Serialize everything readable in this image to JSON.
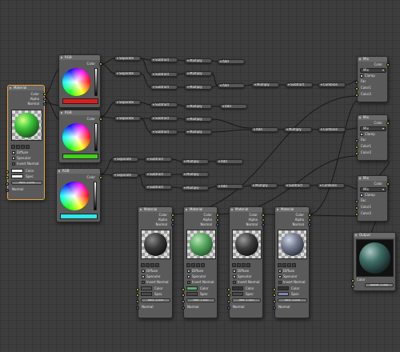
{
  "node_titles": {
    "material": "Material",
    "rgb": "RGB",
    "mix": "Mix",
    "output": "Output",
    "separate": "Separate",
    "subtract": "Subtract",
    "multiply": "Multiply",
    "add": "Add",
    "combine": "Combine"
  },
  "sockets": {
    "color": "Color",
    "alpha": "Alpha",
    "normal": "Normal",
    "fac": "Fac",
    "color1": "Color1",
    "color2": "Color2",
    "spec": "Spec",
    "refl": "Refl"
  },
  "options": {
    "diffuse": "Diffuse",
    "specular": "Specular",
    "invert_normal": "Invert Normal",
    "clamp": "Clamp",
    "mix_mode": "Mix",
    "refl_value": "Refl: 1.000",
    "alpha_value": "Alpha: 1.000"
  },
  "colors": {
    "background": "#3d3d3d",
    "node_body": "#5a5a5a",
    "node_header": "#6a6a6a",
    "socket_color": "#cccc33",
    "socket_value": "#a1a1a1",
    "socket_vector": "#6363c7",
    "selected_outline": "#e8a33e",
    "rgb1_swatch": "#e21a1a",
    "rgb2_swatch": "#3fd11a",
    "rgb3_swatch": "#30e6e6"
  },
  "icons": [
    "collapse-triangle-icon",
    "node-socket-icon",
    "checkbox-check-icon",
    "dropdown-arrow-icon"
  ]
}
